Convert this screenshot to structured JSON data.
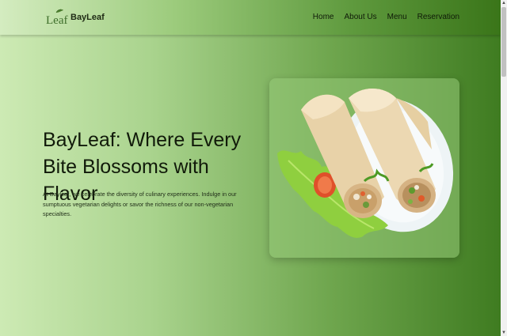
{
  "navbar": {
    "logo_text": "Leaf",
    "brand": "BayLeaf",
    "links": [
      "Home",
      "About Us",
      "Menu",
      "Reservation"
    ]
  },
  "hero": {
    "title": "BayLeaf: Where Every Bite Blossoms with Flavor",
    "description": "At Bayleaf, we celebrate the diversity of culinary experiences. Indulge in our sumptuous vegetarian delights or savor the richness of our non-vegetarian specialties.",
    "image": "food-wraps-image"
  },
  "colors": {
    "gradient_start": "#cdeab4",
    "gradient_end": "#3d7a1f",
    "text_dark": "#111a0a"
  }
}
